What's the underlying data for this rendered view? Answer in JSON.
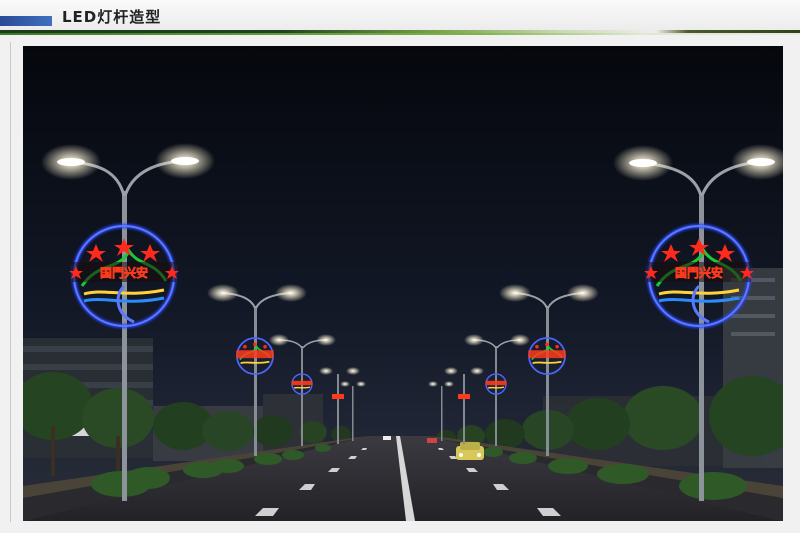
{
  "header": {
    "title": "LED灯杆造型",
    "accent_color": "#2a4a96"
  },
  "scene": {
    "sign_text": "国門兴安",
    "sign_icon": "lamp-pole-decoration-icon",
    "colors": {
      "sky": "#0c1019",
      "road": "#26262a",
      "lamp_glow": "#fff7dc",
      "neon_blue": "#2a46ff",
      "neon_red": "#ff2a1c",
      "neon_green": "#1ec832",
      "neon_yellow": "#ffd23a"
    }
  }
}
